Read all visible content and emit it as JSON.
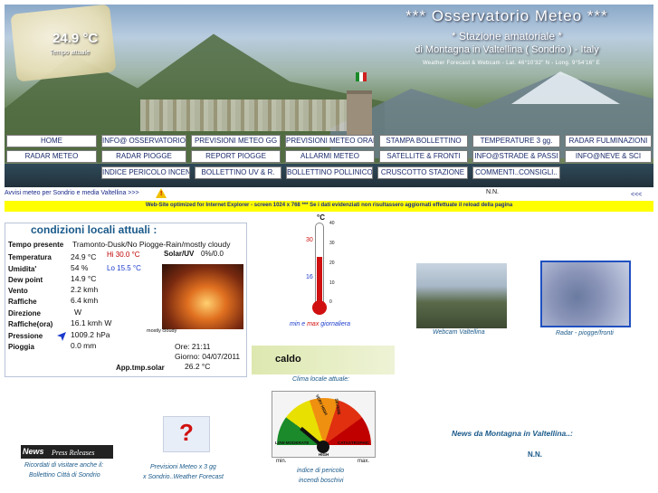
{
  "header": {
    "temp_now": "24.9 °C",
    "temp_now_label": "Tempo attuale",
    "title": "*** Osservatorio  Meteo ***",
    "subtitle": "* Stazione  amatoriale *",
    "subtitle2": "di Montagna in Valtellina ( Sondrio ) - Italy",
    "coords": "Weather Forecast & Webcam - Lat. 46°10'32\" N - Long. 9°54'16\" E"
  },
  "nav": {
    "row1": [
      "HOME",
      "INFO@ OSSERVATORIO",
      "PREVISIONI  METEO  GG",
      "PREVISIONI METEO ORARIE",
      "STAMPA  BOLLETTINO",
      "TEMPERATURE  3  gg.",
      "RADAR FULMINAZIONI"
    ],
    "row2": [
      "RADAR   METEO",
      "RADAR  PIOGGE",
      "REPORT  PIOGGE",
      "ALLARMI   METEO",
      "SATELLITE  &  FRONTI",
      "INFO@STRADE & PASSI",
      "INFO@NEVE & SCI"
    ],
    "row3": [
      "INDICE PERICOLO INCENDI",
      "BOLLETTINO UV &  R.",
      "BOLLETTINO POLLINICO",
      "CRUSCOTTO  STAZIONE",
      "COMMENTI..CONSIGLI.."
    ]
  },
  "ticker": {
    "text": "Avvisi meteo per Sondrio e media Valtellina  >>>",
    "warn_mark": "!",
    "nn": "N.N.",
    "back": "<<<"
  },
  "banner": {
    "text": "Web-Site optimized for Internet Explorer - screen 1024 x 768   ***   Se i dati evidenziati non risultassero aggiornati effettuate il reload della pagina"
  },
  "conditions": {
    "title": "condizioni locali attuali :",
    "rows": [
      {
        "label": "Tempo presente",
        "value": "Tramonto-Dusk/No Piogge-Rain/mostly cloudy"
      },
      {
        "label": "Temperatura",
        "value": "24.9 °C"
      },
      {
        "label": "Umidita'",
        "value": "54 %"
      },
      {
        "label": "Dew point",
        "value": "14.9 °C"
      },
      {
        "label": "Vento",
        "value": "2.2 kmh"
      },
      {
        "label": "Raffiche",
        "value": "6.4 kmh"
      },
      {
        "label": "Direzione",
        "value": "W"
      },
      {
        "label": "Raffiche(ora)",
        "value": "16.1 kmh  W"
      },
      {
        "label": "Pressione",
        "value": "1009.2 hPa"
      },
      {
        "label": "Pioggia",
        "value": "0.0 mm"
      }
    ],
    "hi": "Hi 30.0 °C",
    "lo": "Lo 15.5 °C",
    "solar_label": "Solar/UV",
    "solar_value": "0%/0.0",
    "cloudy_label": "mostly cloudy",
    "ore": "Ore: 21:11",
    "giorno": "Giorno: 04/07/2011",
    "app_label": "App.tmp.solar",
    "app_value": "26.2 °C"
  },
  "thermometer": {
    "unit": "°C",
    "ticks": [
      "40",
      "30",
      "20",
      "10",
      "0"
    ],
    "max": "30",
    "min": "16",
    "caption_min": "min",
    "caption_e": "e",
    "caption_max": "max",
    "caption_rest": "giornaliera",
    "current_fraction": 0.62
  },
  "webcam": {
    "caption": "Webcam  Valtellina"
  },
  "radar": {
    "caption": "Radar - piogge/fronti"
  },
  "clima": {
    "state": "caldo",
    "caption": "Clima locale attuale:"
  },
  "gauge": {
    "labels": [
      "LOW-MODERATE",
      "VERY HIGH",
      "SEVERE",
      "CATASTROPHIC",
      "HIGH"
    ],
    "min": "min.",
    "max": "max.",
    "caption1": "indice di pericolo",
    "caption2": "incendi boschivi"
  },
  "forecast": {
    "icon_glyph": "?",
    "caption1": "Previsioni Meteo x 3 gg",
    "caption2": "x Sondrio..Weather Forecast"
  },
  "news_press": {
    "logo_news": "News",
    "logo_press": "Press Releases",
    "caption1": "Ricordati di visitare anche il:",
    "caption2": "Bollettino Città di Sondrio"
  },
  "news_right": {
    "title": "News da Montagna in Valtellina..:",
    "nn": "N.N."
  },
  "colors": {
    "link_blue": "#1a5a8a",
    "nav_text": "#1a2a6a",
    "banner_yellow": "#ffff00",
    "hi_red": "#c00000",
    "lo_blue": "#1a3acc"
  }
}
